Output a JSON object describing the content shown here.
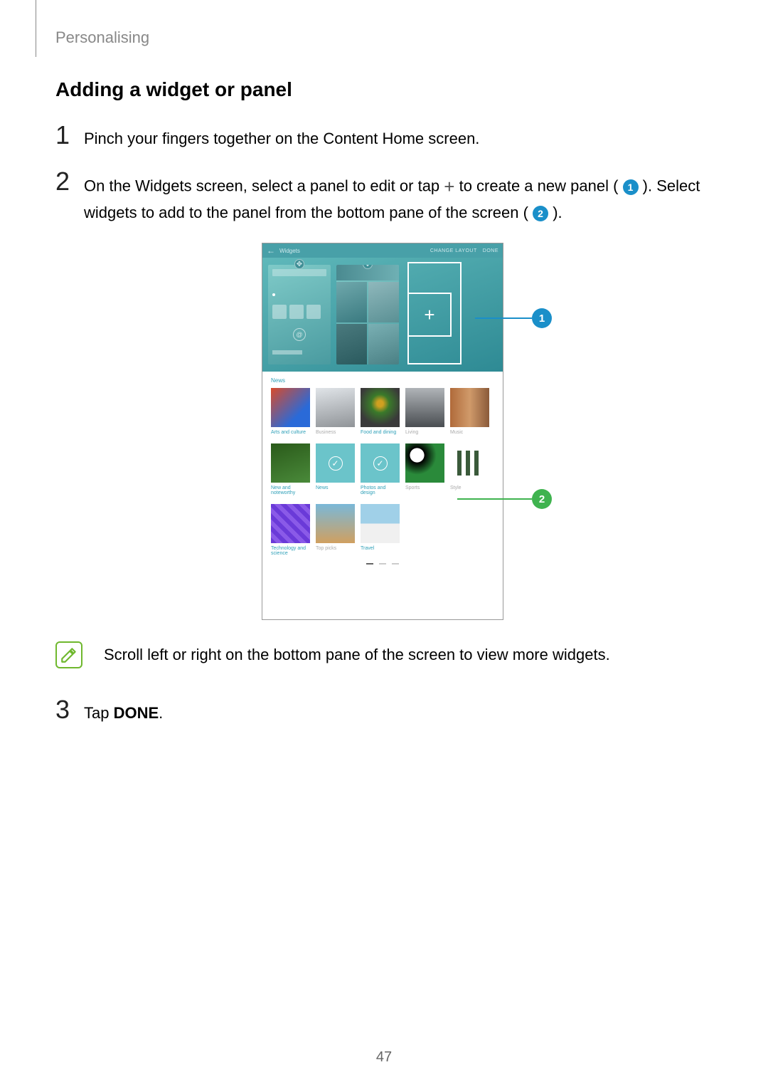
{
  "header_label": "Personalising",
  "section_title": "Adding a widget or panel",
  "steps": {
    "s1": {
      "num": "1",
      "text": "Pinch your fingers together on the Content Home screen."
    },
    "s2": {
      "num": "2",
      "prefix": "On the Widgets screen, select a panel to edit or tap ",
      "mid": " to create a new panel (",
      "mid2": "). Select widgets to add to the panel from the bottom pane of the screen (",
      "suffix": ")."
    },
    "s3": {
      "num": "3",
      "prefix": "Tap ",
      "bold": "DONE",
      "suffix": "."
    }
  },
  "note": "Scroll left or right on the bottom pane of the screen to view more widgets.",
  "screenshot": {
    "topbar_back": "←",
    "topbar_title": "Widgets",
    "topbar_change": "CHANGE LAYOUT",
    "topbar_done": "DONE",
    "add_plus": "+",
    "section_news": "News",
    "row1": [
      {
        "label": "Arts and culture",
        "cls": "t-arts"
      },
      {
        "label": "Business",
        "cls": "t-business",
        "gray": true
      },
      {
        "label": "Food and dining",
        "cls": "t-food"
      },
      {
        "label": "Living",
        "cls": "t-living",
        "gray": true
      },
      {
        "label": "Music",
        "cls": "t-music",
        "gray": true
      }
    ],
    "row2": [
      {
        "label": "New and noteworthy",
        "cls": "t-newnote"
      },
      {
        "label": "News",
        "cls": "sel"
      },
      {
        "label": "Photos and design",
        "cls": "sel"
      },
      {
        "label": "Sports",
        "cls": "t-sports",
        "gray": true
      },
      {
        "label": "Style",
        "cls": "t-style",
        "gray": true
      }
    ],
    "row3": [
      {
        "label": "Technology and science",
        "cls": "t-tech"
      },
      {
        "label": "Top picks",
        "cls": "t-top",
        "gray": true
      },
      {
        "label": "Travel",
        "cls": "t-travel"
      }
    ]
  },
  "callouts": {
    "c1": "1",
    "c2": "2"
  },
  "page_number": "47"
}
